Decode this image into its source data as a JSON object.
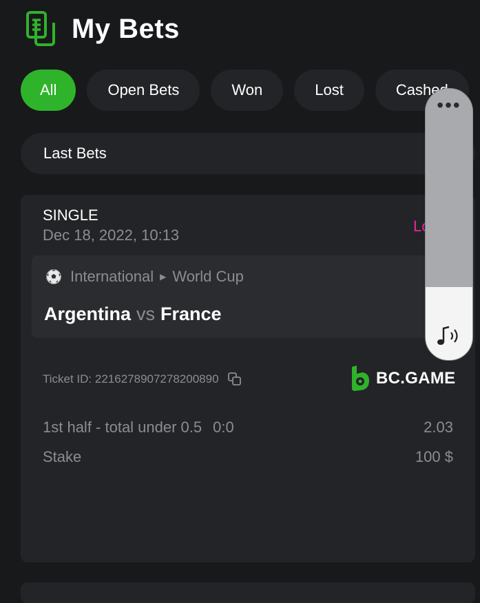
{
  "header": {
    "title": "My Bets",
    "icon": "document-icon"
  },
  "filters": {
    "tabs": [
      {
        "label": "All",
        "active": true
      },
      {
        "label": "Open Bets",
        "active": false
      },
      {
        "label": "Won",
        "active": false
      },
      {
        "label": "Lost",
        "active": false
      },
      {
        "label": "Cashed",
        "active": false
      }
    ]
  },
  "section": {
    "label": "Last Bets"
  },
  "bet": {
    "type": "SINGLE",
    "date": "Dec 18, 2022, 10:13",
    "status": "Lost",
    "league": {
      "country": "International",
      "tournament": "World Cup"
    },
    "home_team": "Argentina",
    "vs": "vs",
    "away_team": "France",
    "ticket_label": "Ticket ID:",
    "ticket_id": "2216278907278200890",
    "brand": "BC.GAME",
    "market": "1st half - total under 0.5",
    "score": "0:0",
    "odds": "2.03",
    "stake_label": "Stake",
    "stake_value": "100 $"
  },
  "volume": {
    "level": 0.27
  },
  "colors": {
    "accent": "#2fb32b",
    "lost": "#e5289a",
    "background": "#18191b",
    "card": "#232427"
  }
}
